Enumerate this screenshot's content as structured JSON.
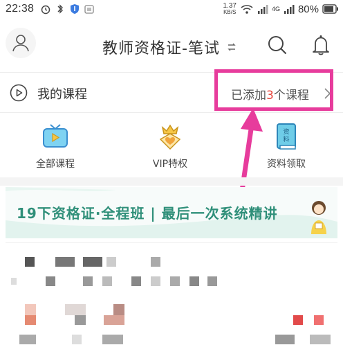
{
  "status_bar": {
    "time": "22:38",
    "net_speed_value": "1.37",
    "net_speed_unit": "KB/S",
    "network": "4G",
    "battery": "80%"
  },
  "header": {
    "title": "教师资格证-笔试",
    "switch_icon": "switch-arrows-icon",
    "search_icon": "search-icon",
    "bell_icon": "bell-icon",
    "avatar_icon": "user-avatar-icon"
  },
  "my_course": {
    "label": "我的课程",
    "added_prefix": "已添加",
    "added_count": "3",
    "added_suffix": "个课程"
  },
  "quick_links": [
    {
      "label": "全部课程",
      "icon": "tv-icon"
    },
    {
      "label": "VIP特权",
      "icon": "crown-heart-icon"
    },
    {
      "label": "资料领取",
      "icon": "book-icon"
    }
  ],
  "book_icon_text_top": "资",
  "book_icon_text_bottom": "料",
  "banner": {
    "text": "19下资格证·全程班 | 最后一次系统精讲"
  },
  "colors": {
    "annotation": "#e73c9c",
    "accent_red": "#e8433a",
    "banner_green": "#2f8f79"
  }
}
